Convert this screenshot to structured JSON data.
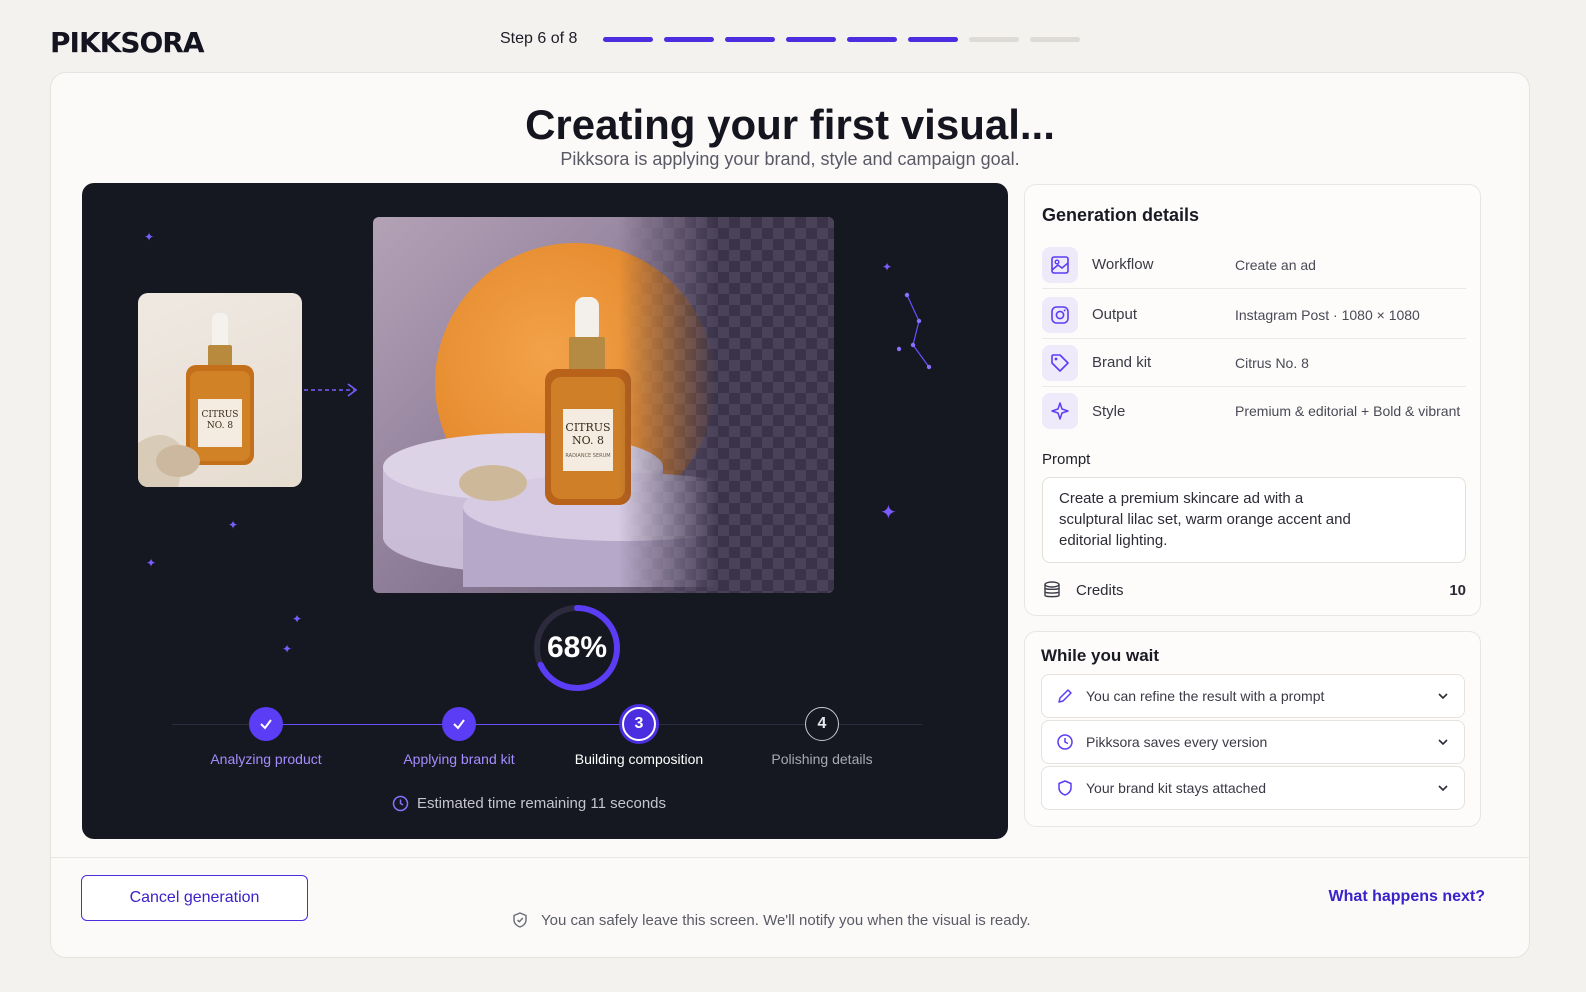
{
  "brand": {
    "logo": "PIKKSORA",
    "accent": "#4a2ee0"
  },
  "stepper": {
    "label": "Step 6 of 8",
    "current": 6,
    "total": 8
  },
  "header": {
    "title": "Creating your first visual...",
    "subtitle": "Pikksora is applying your brand, style and campaign goal."
  },
  "preview": {
    "source_bottle_label": "CITRUS NO. 8",
    "product_label_line1": "CITRUS",
    "product_label_line2": "NO. 8",
    "product_label_line3": "RADIANCE SERUM",
    "progress_percent": 68,
    "progress_text": "68%"
  },
  "pipeline": [
    {
      "label": "Analyzing product",
      "state": "done",
      "number": "1"
    },
    {
      "label": "Applying brand kit",
      "state": "done",
      "number": "2"
    },
    {
      "label": "Building composition",
      "state": "active",
      "number": "3"
    },
    {
      "label": "Polishing details",
      "state": "todo",
      "number": "4"
    }
  ],
  "eta": "Estimated time remaining 11 seconds",
  "details": {
    "title": "Generation details",
    "rows": [
      {
        "key": "Workflow",
        "value": "Create an ad",
        "icon": "image-icon"
      },
      {
        "key": "Output",
        "value": "Instagram Post · 1080 × 1080",
        "icon": "instagram-icon"
      },
      {
        "key": "Brand kit",
        "value": "Citrus No. 8",
        "icon": "tag-icon"
      },
      {
        "key": "Style",
        "value": "Premium & editorial + Bold & vibrant",
        "icon": "sparkle-icon"
      }
    ],
    "prompt_label": "Prompt",
    "prompt": "Create a premium skincare ad with a sculptural lilac set, warm orange accent and editorial lighting.",
    "credits_label": "Credits",
    "credits_value": "10"
  },
  "wait": {
    "title": "While you wait",
    "items": [
      {
        "label": "You can refine the result with a prompt",
        "icon": "pencil-icon"
      },
      {
        "label": "Pikksora saves every version",
        "icon": "history-icon"
      },
      {
        "label": "Your brand kit stays attached",
        "icon": "shield-icon"
      }
    ]
  },
  "footer": {
    "cancel_label": "Cancel generation",
    "next_label": "What happens next?",
    "note": "You can safely leave this screen. We'll notify you when the visual is ready."
  }
}
